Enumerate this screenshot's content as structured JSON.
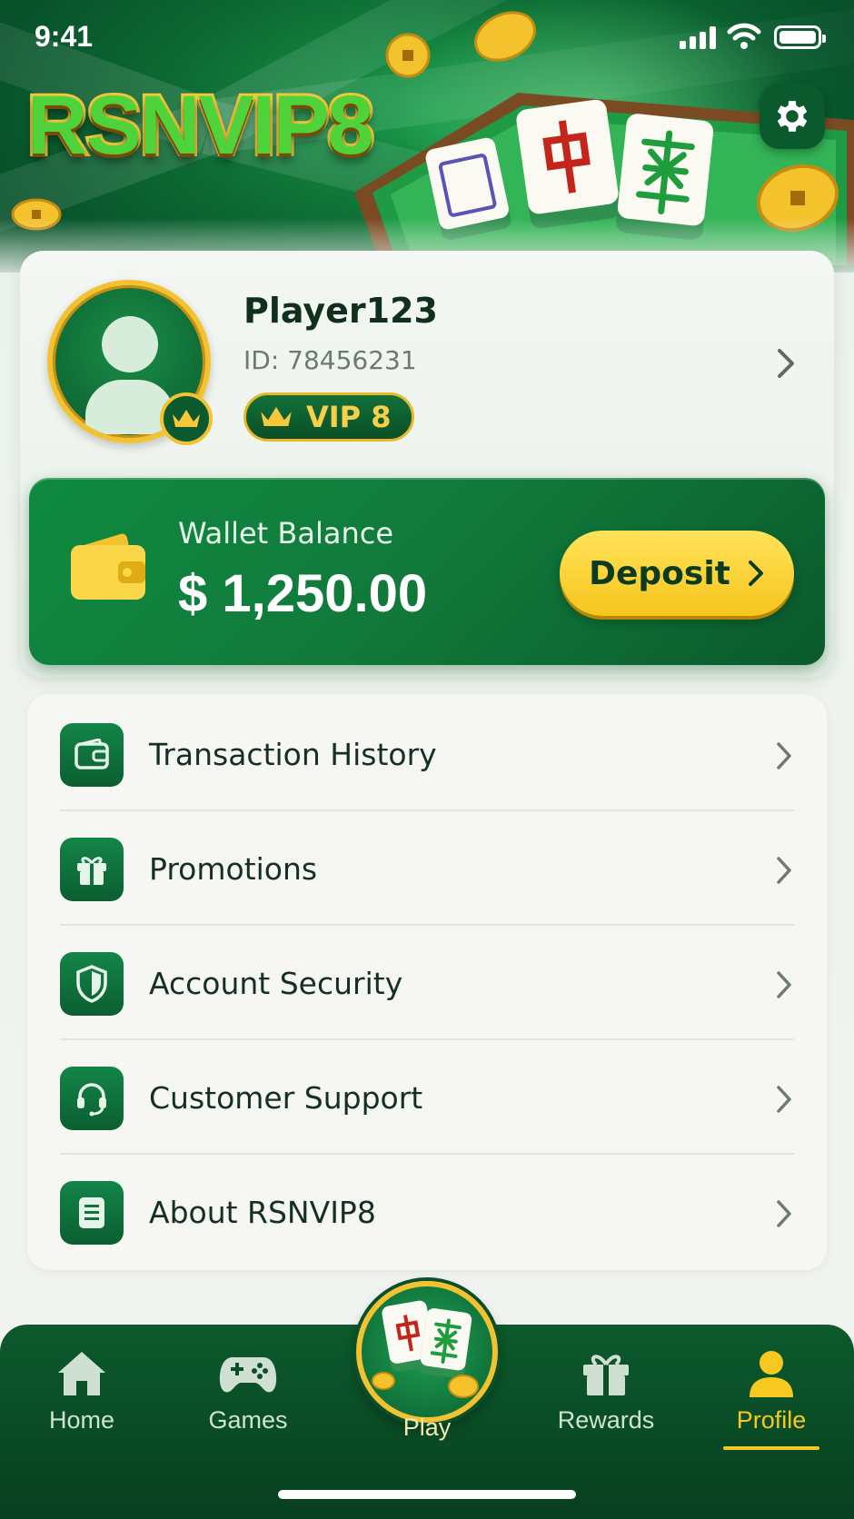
{
  "status_bar": {
    "time": "9:41"
  },
  "header": {
    "logo": "RSNVIP8"
  },
  "profile": {
    "name": "Player123",
    "id": "ID: 78456231",
    "vip": "VIP 8"
  },
  "wallet": {
    "label": "Wallet Balance",
    "amount": "$ 1,250.00",
    "deposit_label": "Deposit"
  },
  "menu": {
    "items": [
      {
        "label": "Transaction History",
        "icon": "wallet-icon"
      },
      {
        "label": "Promotions",
        "icon": "gift-icon"
      },
      {
        "label": "Account Security",
        "icon": "shield-icon"
      },
      {
        "label": "Customer Support",
        "icon": "headset-icon"
      },
      {
        "label": "About RSNVIP8",
        "icon": "document-icon"
      }
    ]
  },
  "nav": {
    "items": [
      {
        "label": "Home",
        "icon": "home-icon"
      },
      {
        "label": "Games",
        "icon": "gamepad-icon"
      },
      {
        "label": "Play",
        "icon": "mahjong-tiles-icon"
      },
      {
        "label": "Rewards",
        "icon": "gift-icon"
      },
      {
        "label": "Profile",
        "icon": "user-icon"
      }
    ],
    "active": "Profile"
  },
  "colors": {
    "brand_green": "#0b5e30",
    "accent_gold": "#f7c820",
    "deposit_yellow": "#ffe35a"
  }
}
